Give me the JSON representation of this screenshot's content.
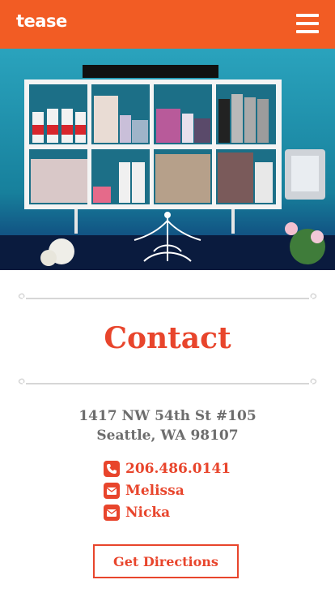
{
  "header": {
    "logo": "tease",
    "menu_icon": "hamburger-menu-icon"
  },
  "hero": {
    "alt": "salon shelving"
  },
  "page": {
    "title": "Contact"
  },
  "address": {
    "line1": "1417 NW 54th St #105",
    "line2": "Seattle, WA 98107"
  },
  "contacts": {
    "phone": {
      "label": "206.486.0141",
      "icon": "phone-icon"
    },
    "email1": {
      "label": "Melissa",
      "icon": "envelope-icon"
    },
    "email2": {
      "label": "Nicka",
      "icon": "envelope-icon"
    }
  },
  "cta": {
    "label": "Get Directions"
  },
  "colors": {
    "brand": "#f25c24",
    "accent": "#e8452c",
    "text_gray": "#6d6d6d",
    "teal": "#1f8aa6"
  }
}
